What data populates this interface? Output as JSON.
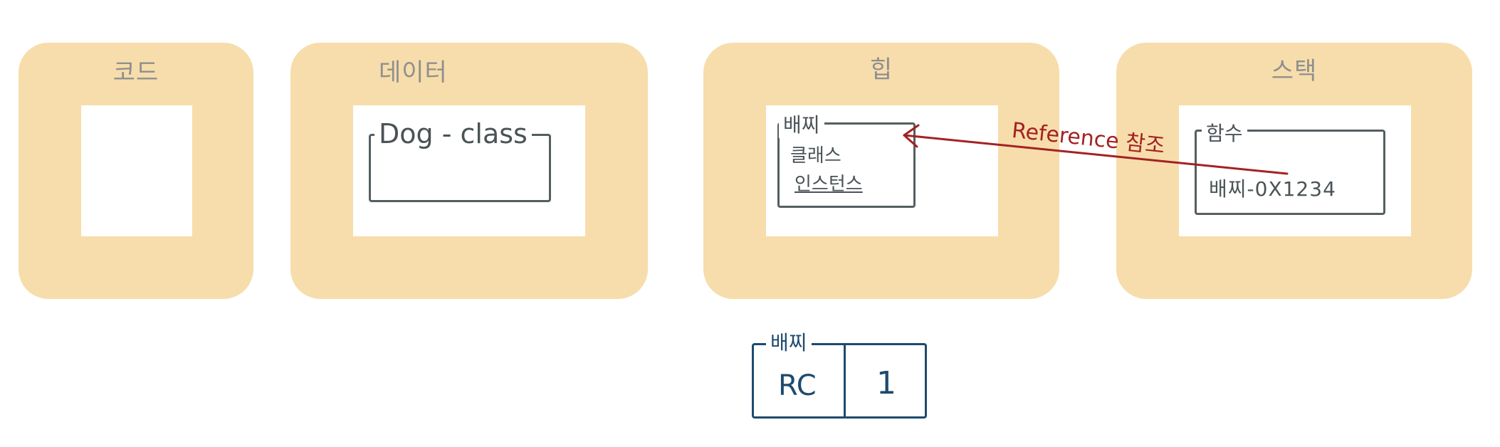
{
  "regions": {
    "code": {
      "title": "코드"
    },
    "data": {
      "title": "데이터"
    },
    "heap": {
      "title": "힙"
    },
    "stack": {
      "title": "스택"
    }
  },
  "data_box": {
    "label": "Dog - class"
  },
  "heap_box": {
    "label": "배찌",
    "line1": "클래스",
    "line2": "인스턴스"
  },
  "stack_box": {
    "label": "함수",
    "value": "배찌-0X1234"
  },
  "reference": {
    "label": "Reference 참조"
  },
  "rc_box": {
    "label": "배찌",
    "rc_label": "RC",
    "rc_value": "1"
  },
  "colors": {
    "region_fill": "#f7ddab",
    "region_title": "#8f8f8f",
    "box_stroke": "#555e60",
    "arrow": "#a32222",
    "rc_stroke": "#1e4a6e"
  }
}
